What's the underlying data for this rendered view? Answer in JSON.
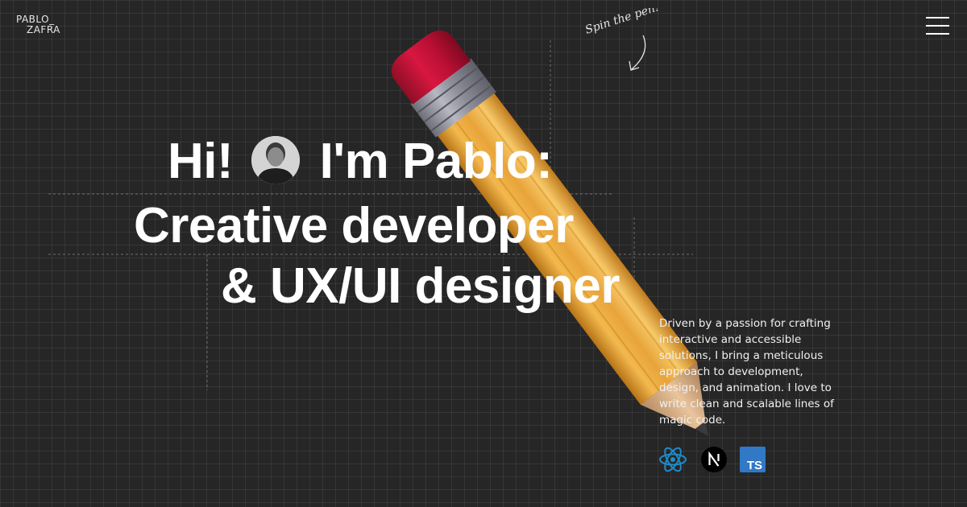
{
  "header": {
    "logo_line1": "PABLO_",
    "logo_line2": "ZAFRA",
    "menu_icon": "hamburger-menu-icon"
  },
  "hint": {
    "text": "Spin the pen!",
    "icon": "curved-arrow-icon"
  },
  "hero": {
    "line1_part1": "Hi!",
    "line1_part2": "I'm Pablo:",
    "line2": "Creative developer",
    "line3": "& UX/UI designer",
    "avatar": "profile-photo"
  },
  "bio": {
    "text": "Driven by a passion for crafting interactive and accessible solutions, I bring a meticulous approach to development, design, and animation. I love to write clean and scalable lines of magic code."
  },
  "tech_stack": [
    {
      "name": "React",
      "icon": "react-icon",
      "color": "#1f8bc9"
    },
    {
      "name": "Next.js",
      "icon": "nextjs-icon",
      "color": "#000000"
    },
    {
      "name": "TypeScript",
      "icon": "typescript-icon",
      "color": "#3178c6",
      "label": "TS"
    }
  ],
  "colors": {
    "background": "#262626",
    "pencil_body": "#e5a33d",
    "eraser": "#c4143a",
    "ferrule": "#9c9ca6"
  }
}
